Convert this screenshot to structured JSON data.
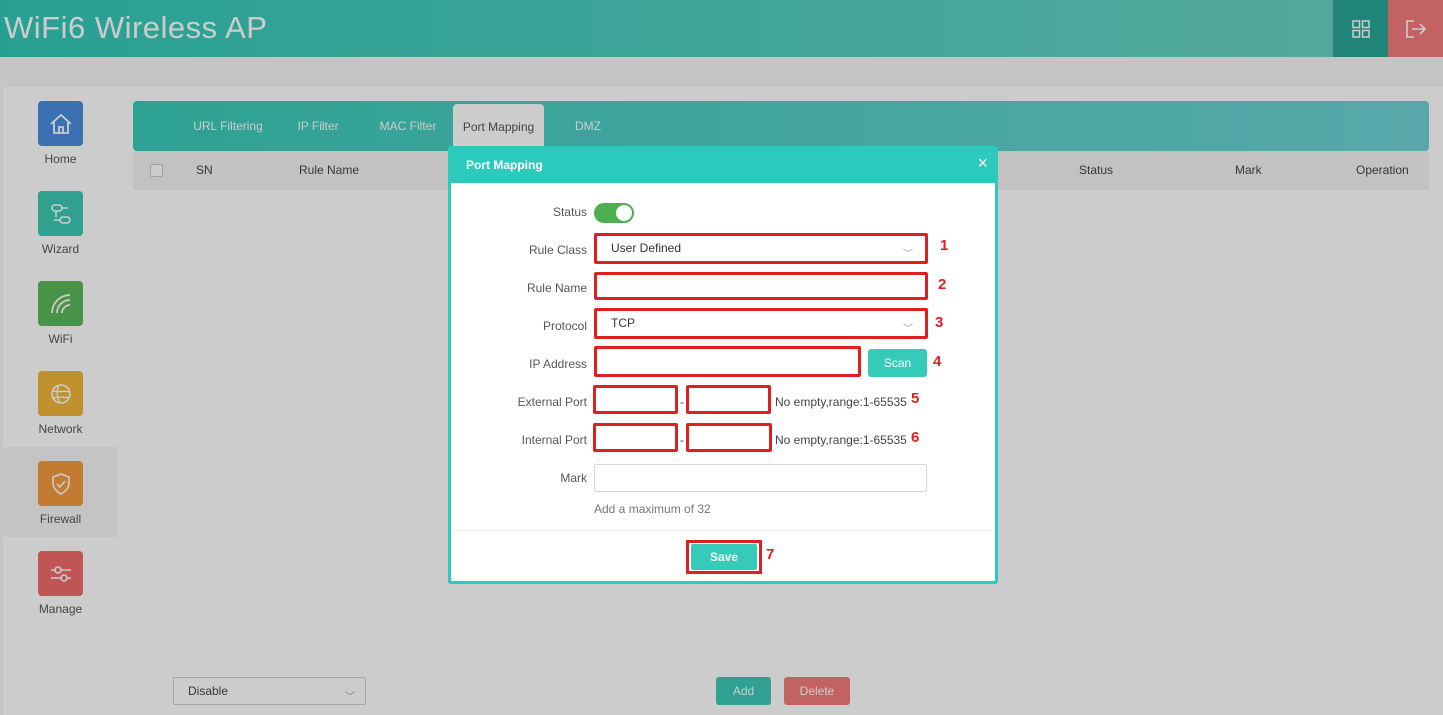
{
  "header": {
    "title": "WiFi6 Wireless AP",
    "grid_icon": "grid-icon",
    "logout_icon": "logout-icon"
  },
  "sidebar": {
    "items": [
      {
        "label": "Home",
        "icon": "home-icon",
        "color": "#4a8ee0"
      },
      {
        "label": "Wizard",
        "icon": "wizard-icon",
        "color": "#3cc8b4"
      },
      {
        "label": "WiFi",
        "icon": "wifi-icon",
        "color": "#5cb85c"
      },
      {
        "label": "Network",
        "icon": "globe-icon",
        "color": "#f0b63a"
      },
      {
        "label": "Firewall",
        "icon": "shield-icon",
        "color": "#f39a3c",
        "active": true
      },
      {
        "label": "Manage",
        "icon": "sliders-icon",
        "color": "#f06b6b"
      }
    ]
  },
  "tabs": [
    {
      "label": "URL Filtering"
    },
    {
      "label": "IP Filter"
    },
    {
      "label": "MAC Filter"
    },
    {
      "label": "Port Mapping",
      "active": true
    },
    {
      "label": "DMZ"
    }
  ],
  "table": {
    "columns": [
      "SN",
      "Rule Name",
      "Status",
      "Mark",
      "Operation"
    ]
  },
  "bottom": {
    "select_value": "Disable",
    "add_label": "Add",
    "delete_label": "Delete"
  },
  "modal": {
    "title": "Port Mapping",
    "close": "×",
    "status_label": "Status",
    "status_on": true,
    "rule_class_label": "Rule Class",
    "rule_class_value": "User Defined",
    "rule_name_label": "Rule Name",
    "rule_name_value": "",
    "protocol_label": "Protocol",
    "protocol_value": "TCP",
    "ip_label": "IP Address",
    "ip_value": "",
    "scan_label": "Scan",
    "ext_port_label": "External Port",
    "int_port_label": "Internal Port",
    "dash": "-",
    "port_hint": "No empty,range:1-65535",
    "mark_label": "Mark",
    "mark_hint": "Add a maximum of 32",
    "save_label": "Save"
  },
  "annotations": [
    "1",
    "2",
    "3",
    "4",
    "5",
    "6",
    "7"
  ],
  "colors": {
    "accent": "#36cbb8",
    "highlight": "#e02020",
    "danger": "#f47b7b"
  }
}
